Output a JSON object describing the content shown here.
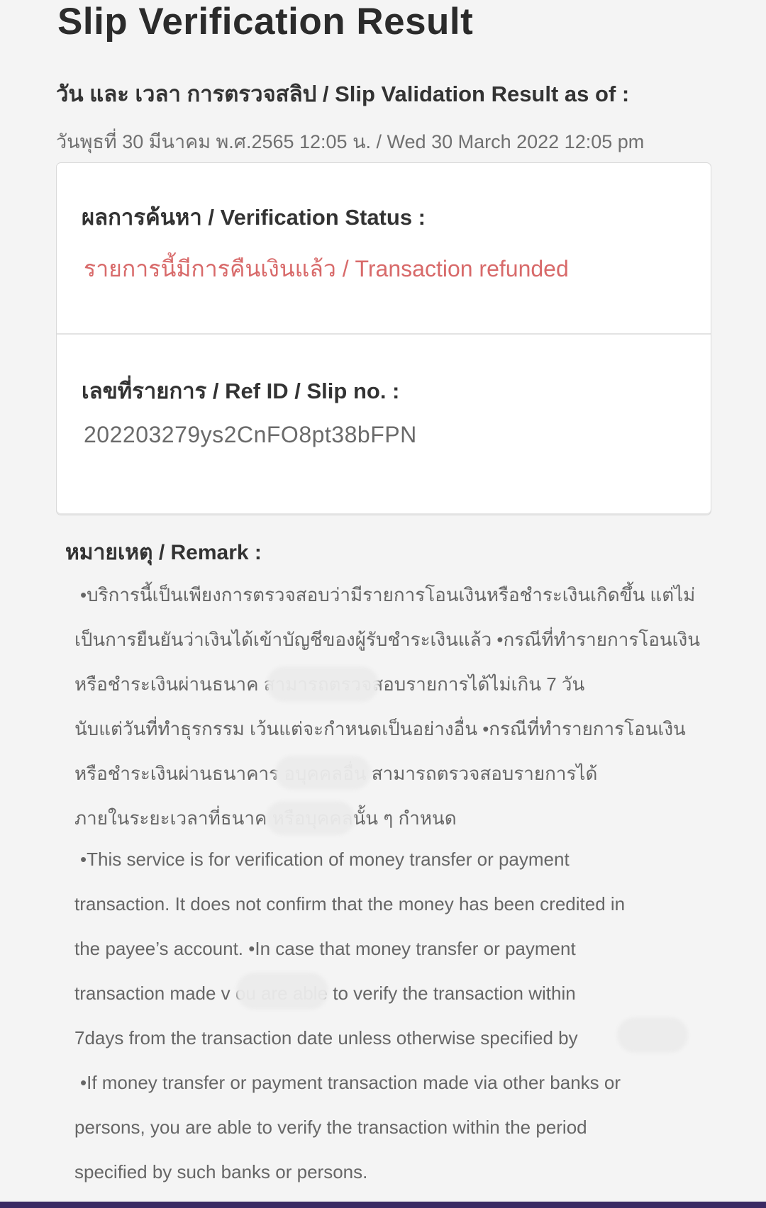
{
  "header": {
    "title": "Slip Verification Result",
    "date_label": "วัน และ เวลา การตรวจสลิป / Slip Validation Result as of :",
    "date_value": "วันพุธที่ 30 มีนาคม พ.ศ.2565 12:05 น. / Wed 30 March 2022 12:05 pm"
  },
  "card": {
    "status_label": "ผลการค้นหา / Verification Status :",
    "status_value": "รายการนี้มีการคืนเงินแล้ว / Transaction refunded",
    "ref_label": "เลขที่รายการ / Ref ID / Slip no. :",
    "ref_value": "202203279ys2CnFO8pt38bFPN"
  },
  "remark": {
    "label": "หมายเหตุ / Remark :",
    "lines": [
      "•บริการนี้เป็นเพียงการตรวจสอบว่ามีรายการโอนเงินหรือชำระเงินเกิดขึ้น แต่ไม่",
      "เป็นการยืนยันว่าเงินได้เข้าบัญชีของผู้รับชำระเงินแล้ว  •กรณีที่ทำรายการโอนเงิน",
      "หรือชำระเงินผ่านธนาค                       สามารถตรวจสอบรายการได้ไม่เกิน 7 วัน",
      "นับแต่วันที่ทำธุรกรรม เว้นแต่จะกำหนดเป็นอย่างอื่น  •กรณีที่ทำรายการโอนเงิน",
      "หรือชำระเงินผ่านธนาคาร                 อบุคคลอื่น สามารถตรวจสอบรายการได้",
      "ภายในระยะเวลาที่ธนาค                    หรือบุคคลนั้น ๆ กำหนด",
      "•This service is for verification of money transfer or payment",
      "transaction. It does not confirm that the money has been credited in",
      "the payee’s account.  •In case that money transfer or payment",
      "transaction made v                ou are able to verify the transaction within",
      "7days from the transaction date unless otherwise specified by",
      "•If money transfer or payment transaction made via other banks or",
      "persons, you are able to verify the transaction within the period",
      "specified by such banks or persons."
    ]
  }
}
